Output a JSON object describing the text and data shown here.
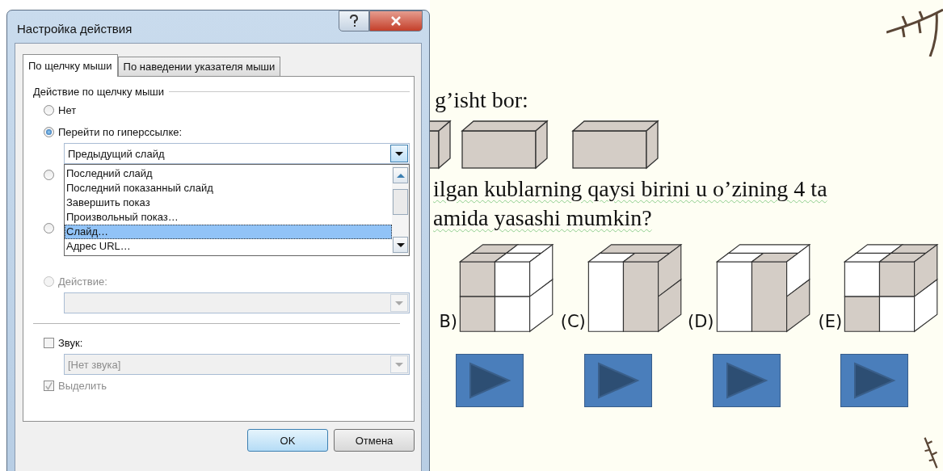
{
  "dialog": {
    "title": "Настройка действия",
    "tabs": [
      {
        "label": "По щелчку мыши",
        "selected": true
      },
      {
        "label": "По наведении указателя мыши",
        "selected": false
      }
    ],
    "group_title": "Действие по щелчку мыши",
    "none_option": {
      "label": "Нет",
      "selected": false
    },
    "hyperlink_option": {
      "label": "Перейти по гиперссылке:",
      "selected": true,
      "value": "Предыдущий слайд",
      "list": [
        {
          "label": "Последний слайд",
          "selected": false
        },
        {
          "label": "Последний показанный слайд",
          "selected": false
        },
        {
          "label": "Завершить показ",
          "selected": false
        },
        {
          "label": "Произвольный показ…",
          "selected": false
        },
        {
          "label": "Слайд…",
          "selected": true
        },
        {
          "label": "Адрес URL…",
          "selected": false
        }
      ]
    },
    "covered_options": [
      {
        "selected": false
      },
      {
        "selected": false
      }
    ],
    "action_option": {
      "label": "Действие:",
      "selected": false,
      "disabled": true
    },
    "sound": {
      "label": "Звук:",
      "checked": false,
      "value": "[Нет звука]",
      "disabled": true
    },
    "highlight": {
      "label": "Выделить",
      "checked": true,
      "disabled": true
    },
    "buttons": [
      {
        "label": "OK",
        "default": true
      },
      {
        "label": "Отмена",
        "default": false
      }
    ]
  },
  "slide": {
    "intro": "g’isht bor:",
    "question": [
      "ilgan kublarning qaysi birini u o’zining 4 ta",
      "amida yasashi mumkin?"
    ],
    "answers": [
      {
        "label": "B)"
      },
      {
        "label": "(C)"
      },
      {
        "label": "(D)"
      },
      {
        "label": "(E)"
      }
    ]
  }
}
